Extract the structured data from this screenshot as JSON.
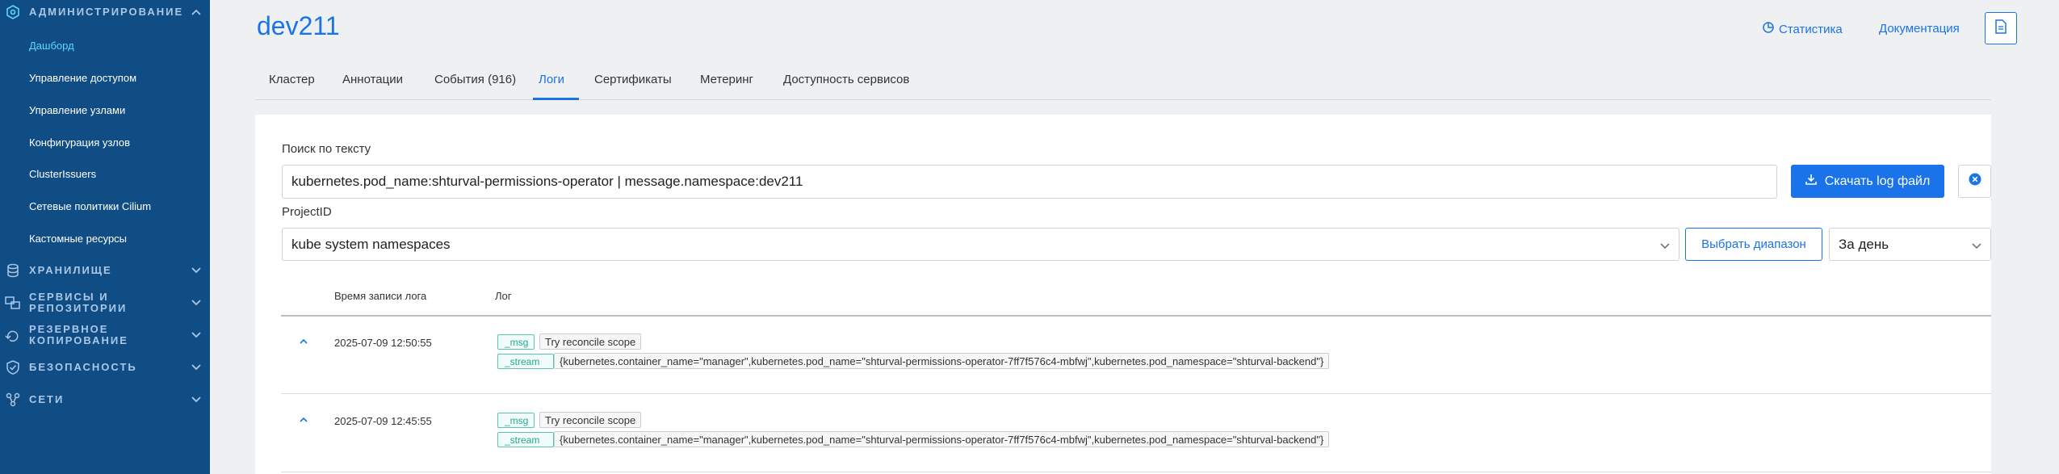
{
  "sidebar": {
    "groups": [
      {
        "label": "АДМИНИСТРИРОВАНИЕ",
        "icon": "admin-hexagon-icon",
        "expanded": true
      },
      {
        "label": "ХРАНИЛИЩЕ",
        "icon": "database-icon"
      },
      {
        "line1": "СЕРВИСЫ И",
        "line2": "РЕПОЗИТОРИИ",
        "icon": "services-icon"
      },
      {
        "line1": "РЕЗЕРВНОЕ",
        "line2": "КОПИРОВАНИЕ",
        "icon": "backup-icon"
      },
      {
        "label": "БЕЗОПАСНОСТЬ",
        "icon": "shield-icon"
      },
      {
        "label": "СЕТИ",
        "icon": "network-icon"
      }
    ],
    "items": [
      {
        "label": "Дашборд",
        "active": true
      },
      {
        "label": "Управление доступом"
      },
      {
        "label": "Управление узлами"
      },
      {
        "label": "Конфигурация узлов"
      },
      {
        "label": "ClusterIssuers"
      },
      {
        "label": "Сетевые политики Cilium"
      },
      {
        "label": "Кастомные ресурсы"
      }
    ]
  },
  "header": {
    "title": "dev211",
    "stats_label": "Статистика",
    "docs_label": "Документация"
  },
  "tabs": [
    {
      "label": "Кластер"
    },
    {
      "label": "Аннотации"
    },
    {
      "label": "События (916)"
    },
    {
      "label": "Логи",
      "active": true
    },
    {
      "label": "Сертификаты"
    },
    {
      "label": "Метеринг"
    },
    {
      "label": "Доступность сервисов"
    }
  ],
  "logs": {
    "search_label": "Поиск по тексту",
    "search_value": "kubernetes.pod_name:shturval-permissions-operator | message.namespace:dev211",
    "download_label": "Скачать log файл",
    "project_label": "ProjectID",
    "project_value": "kube system namespaces",
    "range_button": "Выбрать диапазон",
    "period_value": "За день",
    "columns": {
      "time": "Время записи лога",
      "log": "Лог"
    },
    "rows": [
      {
        "time": "2025-07-09 12:50:55",
        "msg_key": "_msg",
        "msg": "Try reconcile scope",
        "stream_key": "_stream",
        "stream": "{kubernetes.container_name=\"manager\",kubernetes.pod_name=\"shturval-permissions-operator-7ff7f576c4-mbfwj\",kubernetes.pod_namespace=\"shturval-backend\"}"
      },
      {
        "time": "2025-07-09 12:45:55",
        "msg_key": "_msg",
        "msg": "Try reconcile scope",
        "stream_key": "_stream",
        "stream": "{kubernetes.container_name=\"manager\",kubernetes.pod_name=\"shturval-permissions-operator-7ff7f576c4-mbfwj\",kubernetes.pod_namespace=\"shturval-backend\"}"
      }
    ]
  },
  "colors": {
    "sidebar_bg": "#114d85",
    "accent": "#1a73e8",
    "active_nav": "#5bd6ff",
    "tag_green": "#24a892"
  }
}
